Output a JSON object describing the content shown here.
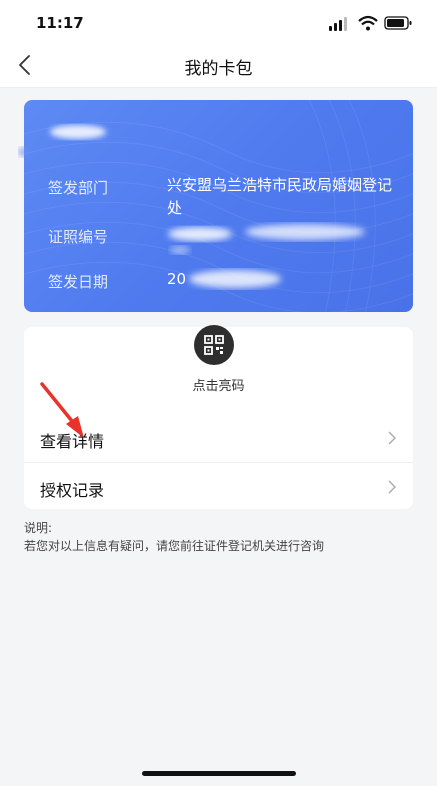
{
  "status_bar": {
    "time": "11:17"
  },
  "header": {
    "title": "我的卡包"
  },
  "card": {
    "rows": [
      {
        "label": "签发部门",
        "value": "兴安盟乌兰浩特市民政局婚姻登记处"
      },
      {
        "label": "证照编号",
        "value": ""
      },
      {
        "label": "签发日期",
        "value": "20"
      }
    ]
  },
  "qr": {
    "label": "点击亮码",
    "icon": "qr-code-icon"
  },
  "menu": {
    "items": [
      {
        "label": "查看详情"
      },
      {
        "label": "授权记录"
      }
    ]
  },
  "note": {
    "title": "说明:",
    "text": "若您对以上信息有疑问，请您前往证件登记机关进行咨询"
  },
  "colors": {
    "card_gradient": [
      "#5e8af4",
      "#4a72e8"
    ],
    "arrow": "#e8322a"
  }
}
